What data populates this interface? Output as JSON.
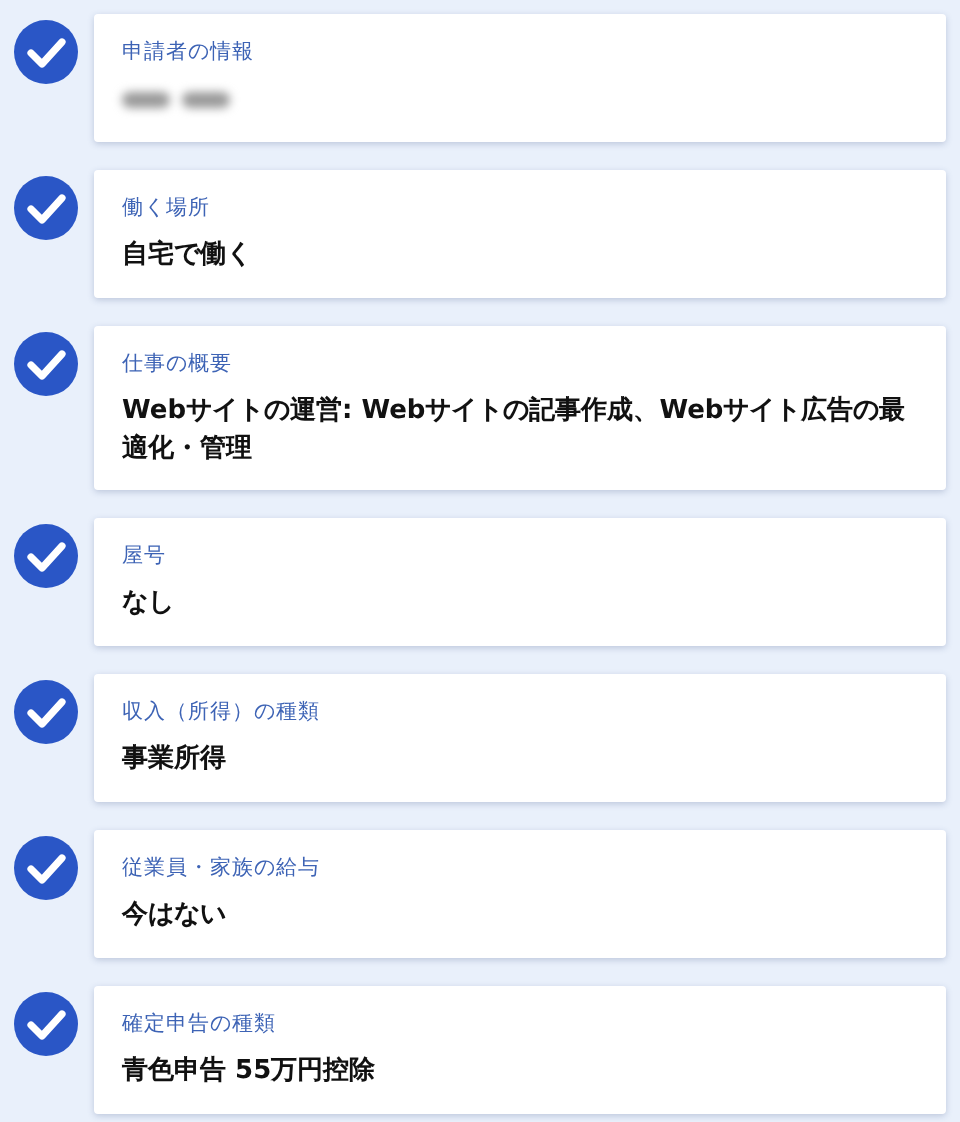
{
  "steps": [
    {
      "done": true,
      "label": "申請者の情報",
      "kind": "redacted"
    },
    {
      "done": true,
      "label": "働く場所",
      "kind": "text",
      "value": "自宅で働く"
    },
    {
      "done": true,
      "label": "仕事の概要",
      "kind": "text",
      "value": "Webサイトの運営: Webサイトの記事作成、Webサイト広告の最適化・管理"
    },
    {
      "done": true,
      "label": "屋号",
      "kind": "text",
      "value": "なし"
    },
    {
      "done": true,
      "label": "収入（所得）の種類",
      "kind": "text",
      "value": "事業所得"
    },
    {
      "done": true,
      "label": "従業員・家族の給与",
      "kind": "text",
      "value": "今はない"
    },
    {
      "done": true,
      "label": "確定申告の種類",
      "kind": "text",
      "value": "青色申告 55万円控除"
    }
  ]
}
